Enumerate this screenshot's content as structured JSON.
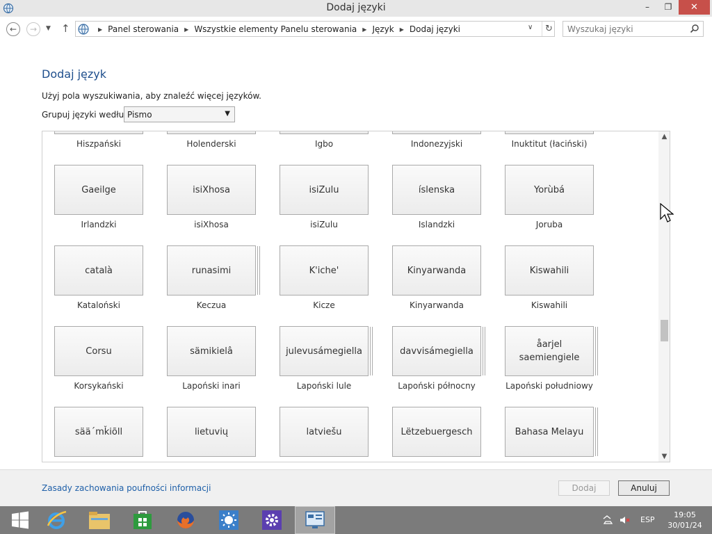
{
  "window": {
    "title": "Dodaj języki",
    "minimize": "–",
    "maximize": "❐",
    "close": "✕"
  },
  "nav": {
    "back": "←",
    "forward": "→",
    "recent": "▼",
    "up": "↑",
    "breadcrumbs": [
      "Panel sterowania",
      "Wszystkie elementy Panelu sterowania",
      "Język",
      "Dodaj języki"
    ],
    "dropdown": "∨",
    "refresh": "↻",
    "search_placeholder": "Wyszukaj języki"
  },
  "page": {
    "heading": "Dodaj język",
    "hint": "Użyj pola wyszukiwania, aby znaleźć więcej języków.",
    "group_label": "Grupuj języki według:",
    "group_value": "Pismo",
    "scroll_position": 0.62
  },
  "top_labels": [
    "Hiszpański",
    "Holenderski",
    "Igbo",
    "Indonezyjski",
    "Inuktitut (łaciński)"
  ],
  "rows": [
    [
      {
        "tile": "Gaeilge",
        "label": "Irlandzki",
        "stack": false
      },
      {
        "tile": "isiXhosa",
        "label": "isiXhosa",
        "stack": false
      },
      {
        "tile": "isiZulu",
        "label": "isiZulu",
        "stack": false
      },
      {
        "tile": "íslenska",
        "label": "Islandzki",
        "stack": false
      },
      {
        "tile": "Yorùbá",
        "label": "Joruba",
        "stack": false
      }
    ],
    [
      {
        "tile": "català",
        "label": "Kataloński",
        "stack": false
      },
      {
        "tile": "runasimi",
        "label": "Keczua",
        "stack": true
      },
      {
        "tile": "K'iche'",
        "label": "Kicze",
        "stack": false
      },
      {
        "tile": "Kinyarwanda",
        "label": "Kinyarwanda",
        "stack": false
      },
      {
        "tile": "Kiswahili",
        "label": "Kiswahili",
        "stack": false
      }
    ],
    [
      {
        "tile": "Corsu",
        "label": "Korsykański",
        "stack": false
      },
      {
        "tile": "sämikielâ",
        "label": "Lapoński inari",
        "stack": false
      },
      {
        "tile": "julevusámegiella",
        "label": "Lapoński lule",
        "stack": true
      },
      {
        "tile": "davvisámegiella",
        "label": "Lapoński północny",
        "stack": true
      },
      {
        "tile": "åarjel saemiengiele",
        "label": "Lapoński południowy",
        "stack": true
      }
    ],
    [
      {
        "tile": "sää´mǩiõll",
        "label": "",
        "stack": false
      },
      {
        "tile": "lietuvių",
        "label": "",
        "stack": false
      },
      {
        "tile": "latviešu",
        "label": "",
        "stack": false
      },
      {
        "tile": "Lëtzebuergesch",
        "label": "",
        "stack": false
      },
      {
        "tile": "Bahasa Melayu",
        "label": "",
        "stack": true
      }
    ]
  ],
  "footer": {
    "privacy": "Zasady zachowania poufności informacji",
    "add": "Dodaj",
    "cancel": "Anuluj"
  },
  "taskbar": {
    "apps": [
      "start-icon",
      "internet-explorer-icon",
      "file-explorer-icon",
      "store-icon",
      "firefox-icon",
      "brightness-icon",
      "settings-icon",
      "control-panel-icon"
    ],
    "lang": "ESP",
    "time": "19:05",
    "date": "30/01/24"
  }
}
